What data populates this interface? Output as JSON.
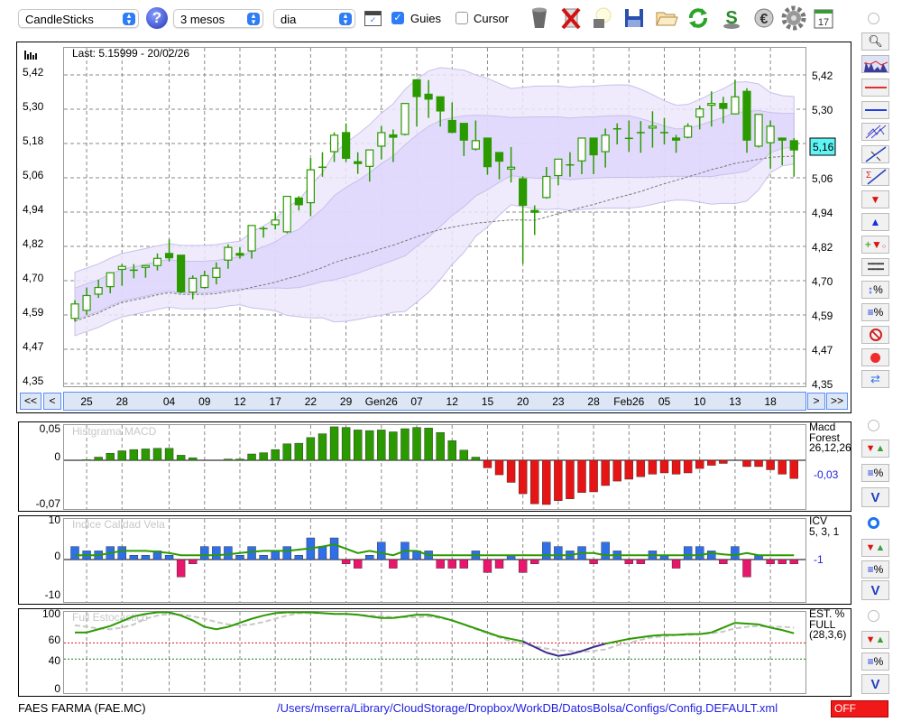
{
  "toolbar": {
    "chart_type": "CandleSticks",
    "period": "3 mesos",
    "interval": "dia",
    "guides_label": "Guies",
    "guides_checked": true,
    "cursor_label": "Cursor",
    "cursor_checked": false
  },
  "main_chart": {
    "last_label": "Last: 5.15999 - 20/02/26",
    "price_marker": "5,16",
    "y_labels": [
      "5,42",
      "5,30",
      "5,18",
      "5,06",
      "4,94",
      "4,82",
      "4,70",
      "4,59",
      "4,47",
      "4,35"
    ],
    "nav": {
      "first": "<<",
      "prev": "<",
      "next": ">",
      "last": ">>"
    }
  },
  "chart_data": {
    "type": "candlestick",
    "ylim": [
      4.35,
      5.42
    ],
    "x_labels": [
      {
        "i": 1,
        "t": "25"
      },
      {
        "i": 4,
        "t": "28"
      },
      {
        "i": 8,
        "t": "04"
      },
      {
        "i": 11,
        "t": "09"
      },
      {
        "i": 14,
        "t": "12"
      },
      {
        "i": 17,
        "t": "17"
      },
      {
        "i": 20,
        "t": "22"
      },
      {
        "i": 23,
        "t": "29"
      },
      {
        "i": 26,
        "t": "Gen26"
      },
      {
        "i": 29,
        "t": "07"
      },
      {
        "i": 32,
        "t": "12"
      },
      {
        "i": 35,
        "t": "15"
      },
      {
        "i": 38,
        "t": "20"
      },
      {
        "i": 41,
        "t": "23"
      },
      {
        "i": 44,
        "t": "28"
      },
      {
        "i": 47,
        "t": "Feb26"
      },
      {
        "i": 50,
        "t": "05"
      },
      {
        "i": 53,
        "t": "10"
      },
      {
        "i": 56,
        "t": "13"
      },
      {
        "i": 59,
        "t": "18"
      }
    ],
    "ohlc": [
      [
        4.576,
        4.639,
        4.565,
        4.626
      ],
      [
        4.604,
        4.683,
        4.588,
        4.655
      ],
      [
        4.66,
        4.71,
        4.647,
        4.683
      ],
      [
        4.686,
        4.734,
        4.663,
        4.734
      ],
      [
        4.746,
        4.765,
        4.689,
        4.756
      ],
      [
        4.743,
        4.764,
        4.715,
        4.743
      ],
      [
        4.753,
        4.759,
        4.717,
        4.759
      ],
      [
        4.759,
        4.801,
        4.742,
        4.784
      ],
      [
        4.801,
        4.85,
        4.773,
        4.786
      ],
      [
        4.795,
        4.795,
        4.663,
        4.668
      ],
      [
        4.667,
        4.725,
        4.642,
        4.715
      ],
      [
        4.683,
        4.741,
        4.679,
        4.724
      ],
      [
        4.718,
        4.77,
        4.694,
        4.75
      ],
      [
        4.778,
        4.833,
        4.748,
        4.822
      ],
      [
        4.801,
        4.823,
        4.783,
        4.797
      ],
      [
        4.81,
        4.898,
        4.783,
        4.898
      ],
      [
        4.887,
        4.894,
        4.856,
        4.887
      ],
      [
        4.901,
        4.943,
        4.884,
        4.917
      ],
      [
        4.876,
        4.999,
        4.871,
        4.999
      ],
      [
        4.993,
        5.0,
        4.95,
        4.97
      ],
      [
        4.977,
        5.132,
        4.93,
        5.091
      ],
      [
        5.1,
        5.152,
        5.067,
        5.1
      ],
      [
        5.154,
        5.221,
        5.118,
        5.211
      ],
      [
        5.22,
        5.252,
        5.118,
        5.131
      ],
      [
        5.119,
        5.152,
        5.077,
        5.113
      ],
      [
        5.103,
        5.16,
        5.05,
        5.16
      ],
      [
        5.173,
        5.243,
        5.127,
        5.22
      ],
      [
        5.212,
        5.231,
        5.118,
        5.204
      ],
      [
        5.214,
        5.321,
        5.21,
        5.321
      ],
      [
        5.403,
        5.403,
        5.241,
        5.345
      ],
      [
        5.353,
        5.402,
        5.271,
        5.336
      ],
      [
        5.344,
        5.344,
        5.241,
        5.295
      ],
      [
        5.262,
        5.325,
        5.218,
        5.221
      ],
      [
        5.252,
        5.252,
        5.139,
        5.194
      ],
      [
        5.163,
        5.262,
        5.158,
        5.192
      ],
      [
        5.201,
        5.201,
        5.074,
        5.102
      ],
      [
        5.151,
        5.151,
        5.058,
        5.121
      ],
      [
        5.094,
        5.17,
        5.047,
        5.1
      ],
      [
        5.06,
        5.068,
        4.765,
        4.968
      ],
      [
        4.95,
        4.968,
        4.865,
        4.944
      ],
      [
        4.995,
        5.101,
        4.991,
        5.068
      ],
      [
        5.071,
        5.128,
        5.037,
        5.128
      ],
      [
        5.108,
        5.152,
        5.067,
        5.108
      ],
      [
        5.122,
        5.201,
        5.076,
        5.201
      ],
      [
        5.201,
        5.201,
        5.076,
        5.143
      ],
      [
        5.154,
        5.234,
        5.099,
        5.211
      ],
      [
        5.233,
        5.252,
        5.179,
        5.233
      ],
      [
        5.2,
        5.262,
        5.153,
        5.2
      ],
      [
        5.22,
        5.26,
        5.15,
        5.22
      ],
      [
        5.236,
        5.294,
        5.168,
        5.242
      ],
      [
        5.22,
        5.271,
        5.179,
        5.22
      ],
      [
        5.201,
        5.212,
        5.15,
        5.194
      ],
      [
        5.204,
        5.252,
        5.2,
        5.242
      ],
      [
        5.274,
        5.313,
        5.231,
        5.302
      ],
      [
        5.315,
        5.363,
        5.241,
        5.321
      ],
      [
        5.321,
        5.344,
        5.252,
        5.304
      ],
      [
        5.285,
        5.403,
        5.283,
        5.344
      ],
      [
        5.363,
        5.374,
        5.15,
        5.194
      ],
      [
        5.173,
        5.283,
        5.168,
        5.283
      ],
      [
        5.185,
        5.262,
        5.095,
        5.242
      ],
      [
        5.201,
        5.201,
        5.107,
        5.194
      ],
      [
        5.192,
        5.201,
        5.067,
        5.16
      ]
    ],
    "macd": {
      "title": "Histgrama MACD",
      "legend": [
        "Macd",
        "Forest",
        "26,12,26"
      ],
      "current": "-0,03",
      "y_labels": [
        {
          "v": 0.05,
          "t": "0,05"
        },
        {
          "v": 0,
          "t": "0"
        },
        {
          "v": -0.07,
          "t": "-0,07"
        }
      ],
      "values": [
        0,
        0.001,
        0.005,
        0.011,
        0.015,
        0.017,
        0.018,
        0.019,
        0.019,
        0.008,
        0.004,
        0,
        0,
        0.002,
        0.002,
        0.01,
        0.012,
        0.017,
        0.026,
        0.027,
        0.036,
        0.042,
        0.053,
        0.052,
        0.048,
        0.047,
        0.048,
        0.045,
        0.05,
        0.052,
        0.051,
        0.044,
        0.031,
        0.016,
        0.005,
        -0.012,
        -0.023,
        -0.035,
        -0.053,
        -0.069,
        -0.07,
        -0.064,
        -0.061,
        -0.051,
        -0.05,
        -0.04,
        -0.033,
        -0.03,
        -0.026,
        -0.022,
        -0.02,
        -0.022,
        -0.02,
        -0.013,
        -0.008,
        -0.005,
        0,
        -0.01,
        -0.01,
        -0.015,
        -0.022,
        -0.029
      ]
    },
    "icv": {
      "title": "Indice Calidad Vela",
      "legend": [
        "ICV",
        "5, 3, 1"
      ],
      "current": "-1",
      "y_labels": [
        {
          "v": 10,
          "t": "10"
        },
        {
          "v": 0,
          "t": "0"
        },
        {
          "v": -10,
          "t": "-10"
        }
      ],
      "values": [
        3,
        2,
        2,
        3,
        3,
        1,
        1,
        2,
        1,
        -4,
        -1,
        3,
        3,
        3,
        1,
        3,
        1,
        2,
        3,
        1,
        5,
        3,
        5,
        -1,
        -2,
        1,
        4,
        -2,
        4,
        2,
        2,
        -2,
        -2,
        -2,
        2,
        -3,
        -2,
        1,
        -3,
        -1,
        4,
        3,
        2,
        3,
        -1,
        4,
        2,
        -1,
        -1,
        2,
        1,
        -2,
        3,
        3,
        2,
        -1,
        3,
        -4,
        1,
        -1,
        -1,
        -1
      ],
      "signal": [
        1,
        1,
        1,
        1.5,
        2,
        2,
        2,
        1.8,
        1.5,
        1,
        1,
        1,
        1,
        1.2,
        1.5,
        1.8,
        2,
        2,
        2,
        2.3,
        2.6,
        3,
        3.5,
        2.5,
        1.5,
        2,
        1.5,
        1,
        2,
        2,
        1,
        1,
        1,
        1,
        1,
        1,
        1,
        1,
        1,
        1,
        1,
        1,
        1,
        1.5,
        1.5,
        1,
        1,
        1,
        1,
        1,
        1,
        1,
        1,
        1,
        1.5,
        1.2,
        1,
        1.5,
        1,
        1,
        1,
        1
      ]
    },
    "stochastic": {
      "title": "Full Estocastico",
      "legend": [
        "EST. %",
        "FULL",
        "(28,3,6)"
      ],
      "y_labels": [
        {
          "v": 100,
          "t": "100"
        },
        {
          "v": 60,
          "t": "60"
        },
        {
          "v": 40,
          "t": "40"
        },
        {
          "v": 0,
          "t": "0"
        }
      ],
      "levels": [
        60,
        40
      ],
      "k": [
        73,
        73,
        77,
        81,
        87,
        93,
        96,
        98,
        98,
        94,
        88,
        80,
        77,
        80,
        85,
        90,
        94,
        97,
        98,
        98,
        98,
        97,
        96,
        96,
        95,
        93,
        91,
        91,
        93,
        95,
        95,
        92,
        88,
        83,
        78,
        73,
        68,
        65,
        62,
        55,
        48,
        44,
        46,
        50,
        55,
        59,
        62,
        65,
        67,
        69,
        70,
        70,
        71,
        71,
        73,
        79,
        85,
        84,
        83,
        79,
        76,
        72
      ],
      "d": [
        82,
        80,
        78,
        77,
        79,
        83,
        90,
        94,
        96,
        95,
        93,
        90,
        86,
        83,
        82,
        83,
        86,
        90,
        94,
        97,
        97,
        97,
        96,
        96,
        95,
        94,
        93,
        92,
        92,
        92,
        93,
        91,
        88,
        83,
        77,
        72,
        67,
        62,
        59,
        56,
        53,
        51,
        50,
        49,
        50,
        52,
        57,
        60,
        64,
        67,
        68,
        70,
        70,
        71,
        72,
        74,
        78,
        80,
        81,
        80,
        80,
        79
      ]
    }
  },
  "footer": {
    "symbol": "FAES FARMA (FAE.MC)",
    "config_path": "/Users/mserra/Library/CloudStorage/Dropbox/WorkDB/DatosBolsa/Configs/Config.DEFAULT.xml",
    "status": "OFF"
  },
  "colors": {
    "candle": "#2b9a00",
    "band": "#e4dcfc",
    "macd_up": "#2b9a00",
    "macd_down": "#e61414",
    "icv_up": "#2f6fe8",
    "icv_down": "#e8176d",
    "marker": "#5ff5f5"
  }
}
